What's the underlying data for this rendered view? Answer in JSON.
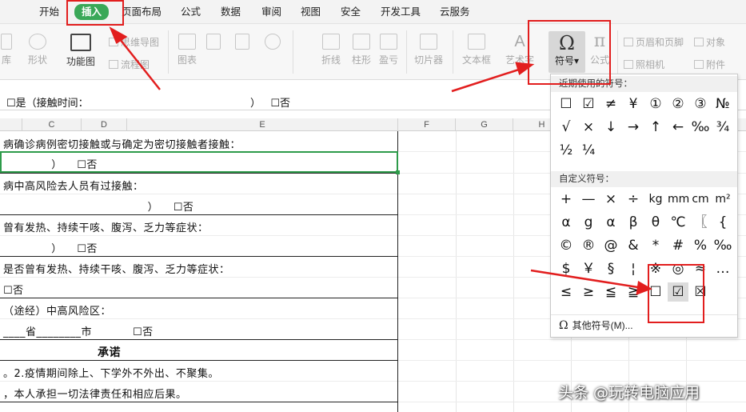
{
  "menubar": {
    "items": [
      "开始",
      "插入",
      "页面布局",
      "公式",
      "数据",
      "审阅",
      "视图",
      "安全",
      "开发工具",
      "云服务"
    ],
    "active_index": 1
  },
  "ribbon": {
    "left_fragments": [
      "库",
      "形状",
      "功能图"
    ],
    "small_items": [
      "思维导图",
      "流程图",
      "页眉和页脚",
      "对象",
      "照相机",
      "附件"
    ],
    "buttons": [
      "图表",
      "折线",
      "柱形",
      "盈亏",
      "切片器",
      "文本框",
      "艺术字",
      "符号",
      "公式"
    ]
  },
  "formula_bar": {
    "text_left": "☐是（接触时间：",
    "text_right": "）   ☐否"
  },
  "columns": [
    "C",
    "D",
    "E",
    "F",
    "G",
    "H"
  ],
  "rows": [
    "病确诊病例密切接触或与确定为密切接触者接触：",
    "             ）    ☐否",
    "病中高风险去人员有过接触：",
    "                                       ）    ☐否",
    "曾有发热、持续干咳、腹泻、乏力等症状：",
    "             ）    ☐否",
    "是否曾有发热、持续干咳、腹泻、乏力等症状：",
    "☐否",
    "（途经）中高风险区：",
    "____省________市           ☐否",
    "承诺",
    "。2.疫情期间除上、下学外不外出、不聚集。",
    "，本人承担一切法律责任和相应后果。"
  ],
  "symbol_panel": {
    "recent_header": "近期使用的符号：",
    "recent": [
      "☐",
      "☑",
      "≠",
      "¥",
      "①",
      "②",
      "③",
      "№",
      "√",
      "×",
      "↓",
      "→",
      "↑",
      "←",
      "‰",
      "¾",
      "½",
      "¼"
    ],
    "custom_header": "自定义符号：",
    "custom": [
      "+",
      "—",
      "×",
      "÷",
      "kg",
      "mm",
      "cm",
      "m²",
      "α",
      "g",
      "α",
      "β",
      "θ",
      "℃",
      "〖",
      "{",
      "©",
      "®",
      "@",
      "&",
      "*",
      "#",
      "%",
      "‰",
      "$",
      "￥",
      "§",
      "¦",
      "※",
      "◎",
      "≈",
      "…",
      "≤",
      "≥",
      "≦",
      "≧",
      "☐",
      "☑",
      "☒"
    ],
    "more_label": "其他符号(M)..."
  },
  "watermark": "头条 @玩转电脑应用",
  "colors": {
    "accent_green": "#3aa858",
    "annotation_red": "#e21e1e"
  }
}
